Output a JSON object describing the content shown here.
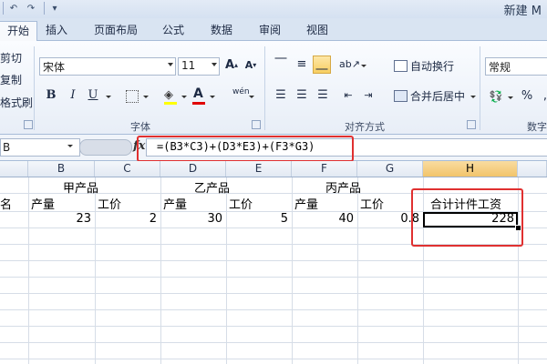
{
  "window": {
    "title": "新建 M"
  },
  "quick_access": {
    "dropdown_glyph": "▾"
  },
  "tabs": [
    "开始",
    "插入",
    "页面布局",
    "公式",
    "数据",
    "审阅",
    "视图"
  ],
  "ribbon": {
    "clipboard": {
      "cut": "剪切",
      "copy": "复制",
      "format_painter": "格式刷"
    },
    "font": {
      "name": "宋体",
      "size": "11",
      "group_label": "字体",
      "grow": "A",
      "shrink": "A",
      "bold": "B",
      "italic": "I",
      "underline": "U",
      "font_color_letter": "A",
      "phonetic": "wén",
      "fill_color": "#ffff00",
      "font_color": "#e00000"
    },
    "alignment": {
      "wrap_text": "自动换行",
      "merge_center": "合并后居中",
      "group_label": "对齐方式"
    },
    "number": {
      "format": "常规",
      "percent": "%",
      "comma": ",",
      "group_label": "数字"
    }
  },
  "formula_bar": {
    "name_box": "B",
    "fx": "fx",
    "formula": "=(B3*C3)+(D3*E3)+(F3*G3)"
  },
  "sheet": {
    "columns": [
      "B",
      "C",
      "D",
      "E",
      "F",
      "G",
      "H"
    ],
    "selected_column": "H",
    "group_headers": [
      "甲产品",
      "乙产品",
      "丙产品"
    ],
    "row2": {
      "a_fragment": "名",
      "b": "产量",
      "c": "工价",
      "d": "产量",
      "e": "工价",
      "f": "产量",
      "g": "工价",
      "h": "合计计件工资"
    },
    "row3": {
      "b": "23",
      "c": "2",
      "d": "30",
      "e": "5",
      "f": "40",
      "g": "0.8",
      "h": "228"
    }
  },
  "highlight_color": "#e03030"
}
